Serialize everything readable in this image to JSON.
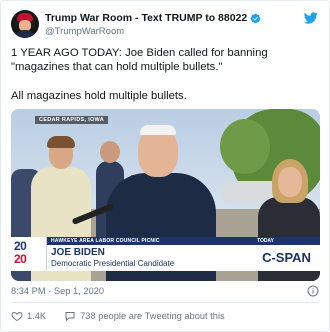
{
  "tweet": {
    "author": {
      "name": "Trump War Room - Text TRUMP to 88022",
      "handle": "@TrumpWarRoom",
      "verified": true
    },
    "text_line1": "1 YEAR AGO TODAY: Joe Biden called for banning \"magazines that can hold multiple bullets.\"",
    "text_line2": "All magazines hold multiple bullets.",
    "media": {
      "location": "CEDAR RAPIDS, IOWA",
      "event": "HAWKEYE AREA LABOR COUNCIL PICNIC",
      "speaker_name": "JOE BIDEN",
      "speaker_title": "Democratic Presidential Candidate",
      "badge_line1": "20",
      "badge_line2": "20",
      "today_label": "TODAY",
      "network": "C-SPAN"
    },
    "timestamp": "8:34 PM · Sep 1, 2020",
    "likes": "1.4K",
    "talking": "738 people are Tweeting about this"
  },
  "colors": {
    "twitter_blue": "#1da1f2",
    "heart_red": "#e0245e",
    "cspan_navy": "#1c3567"
  },
  "icons": {
    "platform": "twitter-bird-icon",
    "verified": "verified-badge-icon",
    "info": "info-icon",
    "like": "heart-icon",
    "reply": "speech-bubble-icon"
  }
}
